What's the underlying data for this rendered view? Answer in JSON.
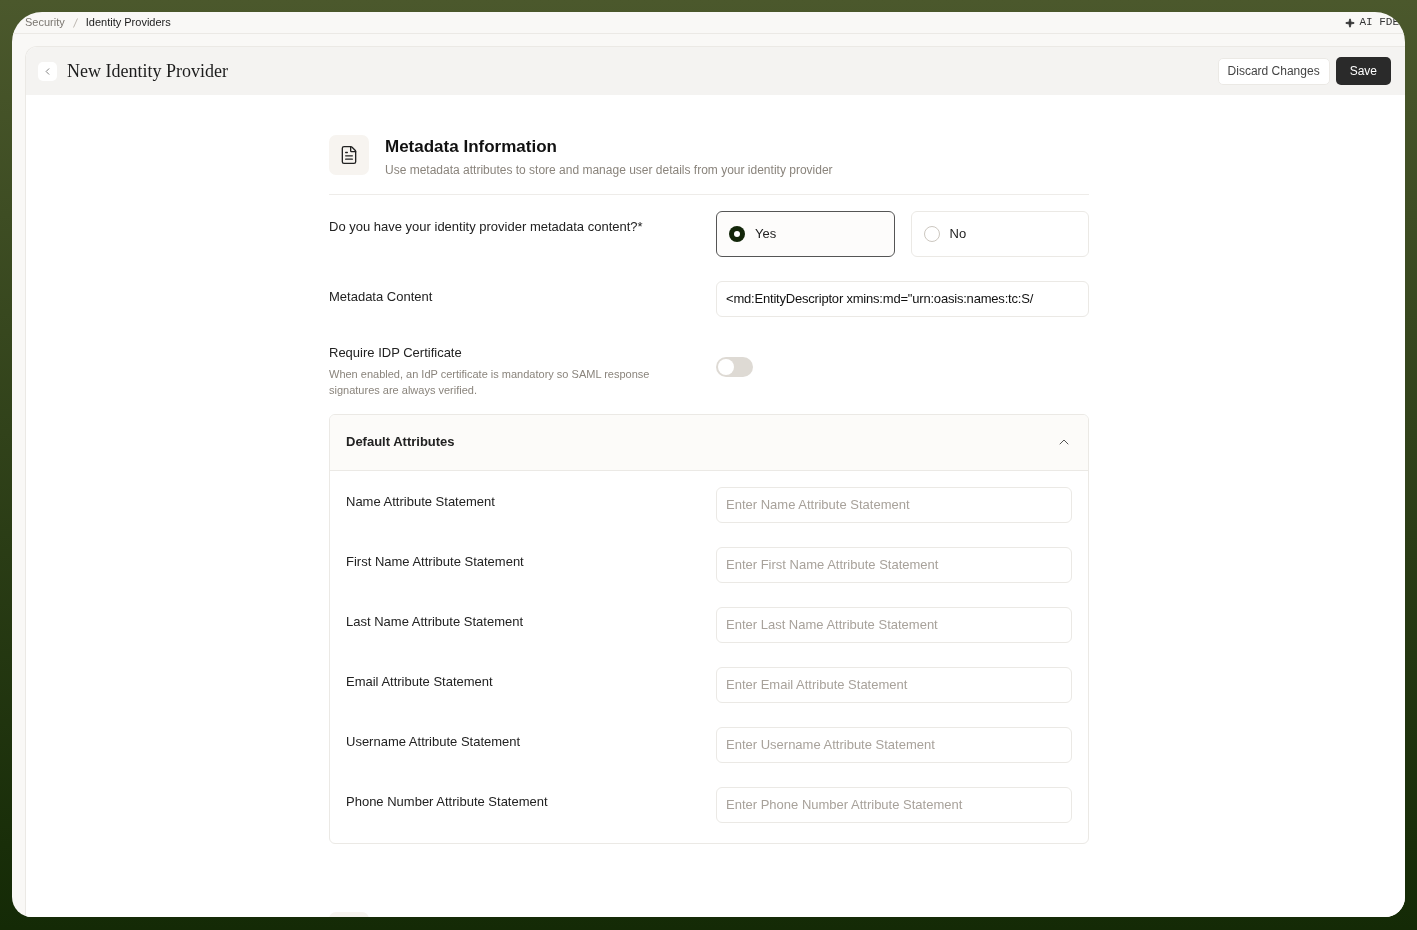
{
  "breadcrumbs": [
    {
      "label": "Security",
      "selected": false
    },
    {
      "label": "Identity Providers",
      "selected": true
    }
  ],
  "assistant_button": {
    "label": "AI FDE"
  },
  "header": {
    "title": "New Identity Provider",
    "buttons": [
      {
        "label": "Discard Changes",
        "kind": "secondary"
      },
      {
        "label": "Save",
        "kind": "primary"
      }
    ]
  },
  "section": {
    "title": "Metadata Information",
    "description": "Use metadata attributes to store and manage user details from your identity provider"
  },
  "metadata_question": {
    "label": "Do you have your identity provider metadata content?*",
    "options": [
      {
        "label": "Yes",
        "selected": true
      },
      {
        "label": "No",
        "selected": false
      }
    ]
  },
  "metadata_content": {
    "label": "Metadata Content",
    "value": "<md:EntityDescriptor xmins:md=\"urn:oasis:names:tc:S/"
  },
  "require_certificate": {
    "label": "Require IDP Certificate",
    "description": "When enabled, an IdP certificate is mandatory so SAML response signatures are always verified.",
    "on": false
  },
  "default_attributes": {
    "title": "Default Attributes",
    "expanded": true,
    "fields": [
      {
        "label": "Name Attribute Statement",
        "placeholder": "Enter Name Attribute Statement"
      },
      {
        "label": "First Name Attribute Statement",
        "placeholder": "Enter First Name Attribute Statement"
      },
      {
        "label": "Last Name Attribute Statement",
        "placeholder": "Enter Last Name Attribute Statement"
      },
      {
        "label": "Email Attribute Statement",
        "placeholder": "Enter Email Attribute Statement"
      },
      {
        "label": "Username Attribute Statement",
        "placeholder": "Enter Username Attribute Statement"
      },
      {
        "label": "Phone Number Attribute Statement",
        "placeholder": "Enter Phone Number Attribute Statement"
      }
    ]
  }
}
